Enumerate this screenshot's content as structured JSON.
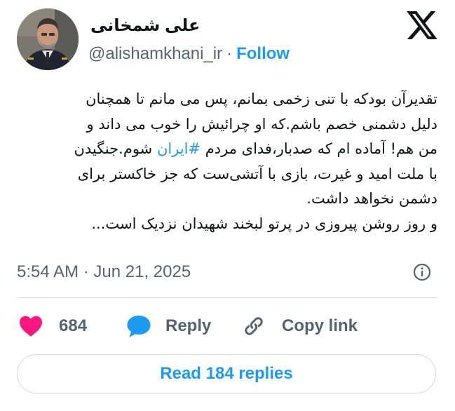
{
  "author": {
    "display_name": "علی شمخانی",
    "handle": "@alishamkhani_ir",
    "separator": "·",
    "follow_label": "Follow"
  },
  "tweet": {
    "lines": [
      "تقدیرآن بودکه با تنی زخمی بمانم، پس می مانم تا همچنان",
      "دلیل دشمنی خصم باشم.که او چرائیش را خوب می داند و",
      "شوم.جنگیدن",
      "با ملت امید و غیرت، بازی با آتشی‌ست که جز خاکستر برای",
      "دشمن نخواهد داشت.",
      "و روز روشن پیروزی در پرتو لبخند شهیدان نزدیک است..."
    ],
    "line3_prefix": "من هم! آماده ام که صدبار،فدای مردم ",
    "hashtag": "#ایران",
    "timestamp": "5:54 AM · Jun 21, 2025"
  },
  "actions": {
    "like_count": "684",
    "reply_label": "Reply",
    "copy_link_label": "Copy link",
    "read_replies_label": "Read 184 replies"
  },
  "icons": {
    "brand": "x-logo-icon",
    "like": "heart-icon",
    "reply": "speech-bubble-icon",
    "copy": "link-icon",
    "info": "info-icon"
  },
  "colors": {
    "accent": "#1d9bf0",
    "like": "#f91880",
    "muted": "#536471",
    "text": "#0f1419"
  }
}
